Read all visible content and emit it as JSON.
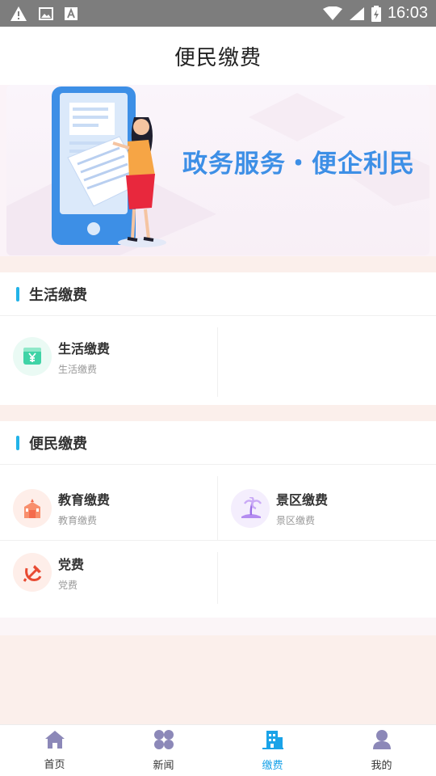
{
  "status_bar": {
    "time": "16:03",
    "icons": [
      "warning-icon",
      "image-icon",
      "font-a-icon",
      "wifi-icon",
      "signal-icon",
      "battery-icon"
    ]
  },
  "header": {
    "title": "便民缴费"
  },
  "banner": {
    "text": "政务服务・便企利民"
  },
  "sections": [
    {
      "title": "生活缴费",
      "items": [
        {
          "title": "生活缴费",
          "subtitle": "生活缴费",
          "icon": "yen-icon",
          "color": "#3fd3a6"
        }
      ]
    },
    {
      "title": "便民缴费",
      "items": [
        {
          "title": "教育缴费",
          "subtitle": "教育缴费",
          "icon": "school-icon",
          "color": "#f46b4d"
        },
        {
          "title": "景区缴费",
          "subtitle": "景区缴费",
          "icon": "palm-tree-icon",
          "color": "#b48cf0"
        },
        {
          "title": "党费",
          "subtitle": "党费",
          "icon": "hammer-sickle-icon",
          "color": "#e84a32"
        }
      ]
    }
  ],
  "bottom_nav": [
    {
      "label": "首页",
      "icon": "home-icon",
      "active": false
    },
    {
      "label": "新闻",
      "icon": "clover-icon",
      "active": false
    },
    {
      "label": "缴费",
      "icon": "building-icon",
      "active": true
    },
    {
      "label": "我的",
      "icon": "user-icon",
      "active": false
    }
  ],
  "colors": {
    "accent": "#1aa3e8",
    "nav_inactive_icon": "#8c88b8",
    "page_background": "#fbefeb"
  }
}
